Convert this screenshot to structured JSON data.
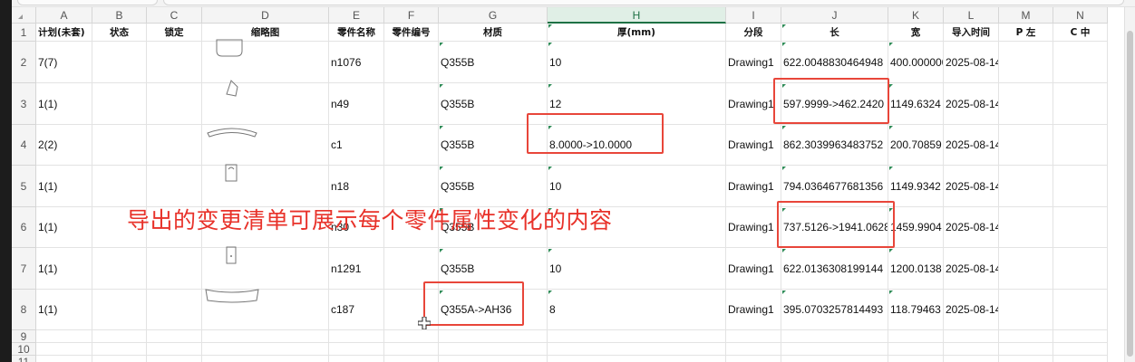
{
  "columns": [
    "A",
    "B",
    "C",
    "D",
    "E",
    "F",
    "G",
    "H",
    "I",
    "J",
    "K",
    "L",
    "M",
    "N"
  ],
  "selected_column": "H",
  "row_numbers": [
    "1",
    "2",
    "3",
    "4",
    "5",
    "6",
    "7",
    "8",
    "9",
    "10",
    "11"
  ],
  "headers": {
    "A": "计划(未套)",
    "B": "状态",
    "C": "锁定",
    "D": "缩略图",
    "E": "零件名称",
    "F": "零件编号",
    "G": "材质",
    "H": "厚(mm)",
    "I": "分段",
    "J": "长",
    "K": "宽",
    "L": "导入时间",
    "M": "P 左",
    "N": "C 中"
  },
  "rows": [
    {
      "A": "7(7)",
      "E": "n1076",
      "G": "Q355B",
      "H": "10",
      "I": "Drawing1",
      "J": "622.0048830464948",
      "K": "400.000000",
      "L": "2025-08-14"
    },
    {
      "A": "1(1)",
      "E": "n49",
      "G": "Q355B",
      "H": "12",
      "I": "Drawing1",
      "J": "597.9999->462.2420",
      "K": "1149.6324",
      "L": "2025-08-14"
    },
    {
      "A": "2(2)",
      "E": "c1",
      "G": "Q355B",
      "H": "8.0000->10.0000",
      "I": "Drawing1",
      "J": "862.3039963483752",
      "K": "200.70859",
      "L": "2025-08-14"
    },
    {
      "A": "1(1)",
      "E": "n18",
      "G": "Q355B",
      "H": "10",
      "I": "Drawing1",
      "J": "794.0364677681356",
      "K": "1149.9342",
      "L": "2025-08-14"
    },
    {
      "A": "1(1)",
      "E": "n30",
      "G": "Q355B",
      "H": "",
      "I": "Drawing1",
      "J": "737.5126->1941.0628",
      "K": "1459.9904",
      "L": "2025-08-14"
    },
    {
      "A": "1(1)",
      "E": "n1291",
      "G": "Q355B",
      "H": "10",
      "I": "Drawing1",
      "J": "622.0136308199144",
      "K": "1200.0138",
      "L": "2025-08-14"
    },
    {
      "A": "1(1)",
      "E": "c187",
      "G": "Q355A->AH36",
      "H": "8",
      "I": "Drawing1",
      "J": "395.0703257814493",
      "K": "118.79463",
      "L": "2025-08-14"
    }
  ],
  "annotation": "导出的变更清单可展示每个零件属性变化的内容",
  "colors": {
    "accent_green": "#1e7145",
    "highlight_red": "#e8463a",
    "annotation_red": "#e8322a"
  }
}
